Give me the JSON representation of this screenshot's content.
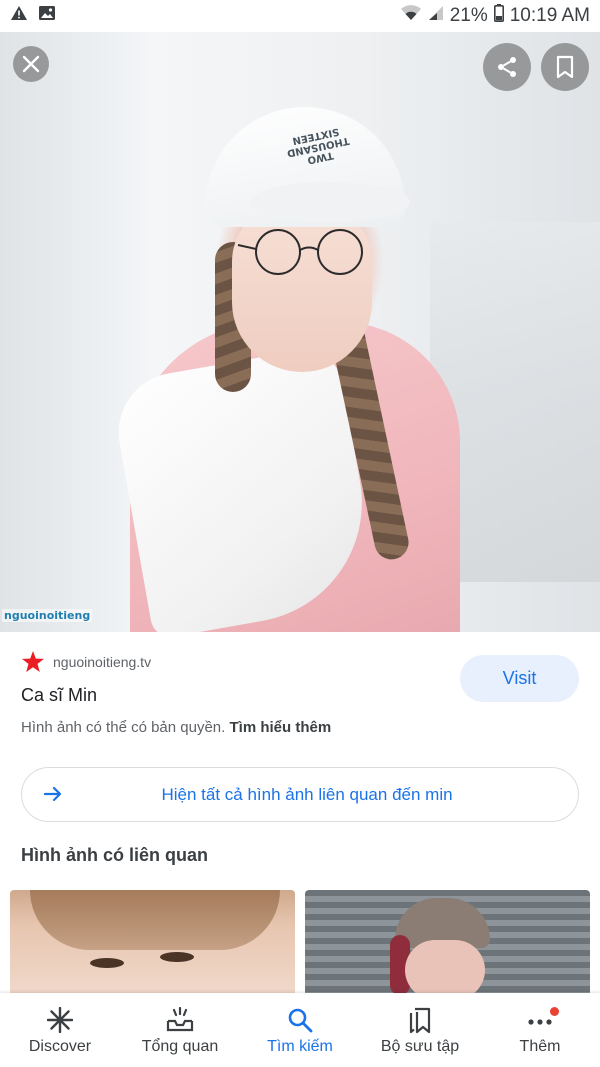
{
  "status_bar": {
    "battery": "21%",
    "time": "10:19 AM",
    "icons": [
      "alert-icon",
      "image-notification-icon",
      "wifi-icon",
      "signal-icon",
      "battery-icon"
    ]
  },
  "viewer": {
    "image_text": {
      "cap_print": "TWO THOUSAND SIXTEEN",
      "watermark": "nguoinoitieng"
    },
    "close_icon": "close-icon",
    "share_icon": "share-icon",
    "bookmark_icon": "bookmark-icon"
  },
  "result": {
    "source": "nguoinoitieng.tv",
    "title": "Ca sĩ Min",
    "visit_label": "Visit",
    "copyright_text": "Hình ảnh có thể có bản quyền.",
    "learn_more": "Tìm hiểu thêm",
    "related_all_label": "Hiện tất cả hình ảnh liên quan đến min",
    "related_section_title": "Hình ảnh có liên quan"
  },
  "bottom_nav": {
    "items": [
      {
        "label": "Discover",
        "icon": "asterisk-icon"
      },
      {
        "label": "Tổng quan",
        "icon": "inbox-icon"
      },
      {
        "label": "Tìm kiếm",
        "icon": "search-icon"
      },
      {
        "label": "Bộ sưu tập",
        "icon": "collections-icon"
      },
      {
        "label": "Thêm",
        "icon": "more-icon"
      }
    ],
    "active_index": 2
  },
  "colors": {
    "accent": "#1a73e8",
    "visit_bg": "#e8f0fe",
    "favicon_red": "#ea1c24",
    "badge": "#ea4335"
  }
}
